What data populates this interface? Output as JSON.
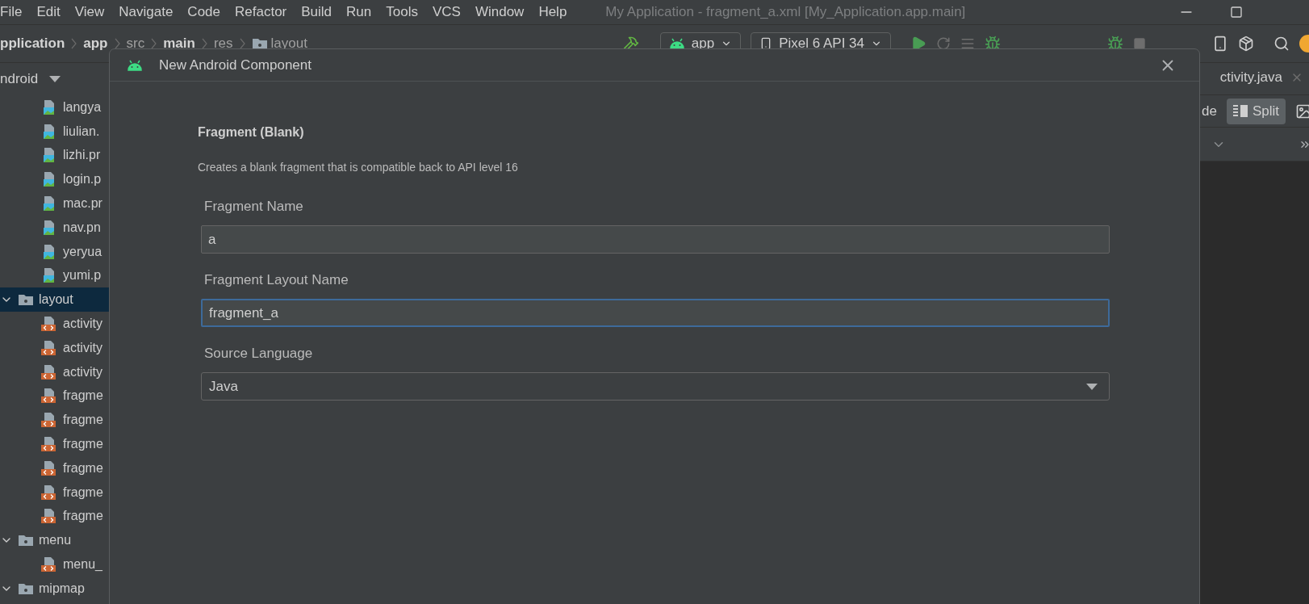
{
  "menu": [
    "File",
    "Edit",
    "View",
    "Navigate",
    "Code",
    "Refactor",
    "Build",
    "Run",
    "Tools",
    "VCS",
    "Window",
    "Help"
  ],
  "window_title": "My Application - fragment_a.xml [My_Application.app.main]",
  "breadcrumb": [
    {
      "label": "pplication",
      "bold": true,
      "kind": "plain"
    },
    {
      "label": "app",
      "bold": true,
      "kind": "plain"
    },
    {
      "label": "src",
      "bold": false,
      "kind": "plain"
    },
    {
      "label": "main",
      "bold": true,
      "kind": "plain"
    },
    {
      "label": "res",
      "bold": false,
      "kind": "plain"
    },
    {
      "label": "layout",
      "bold": false,
      "kind": "folder"
    }
  ],
  "toolbar": {
    "run_config": "app",
    "device": "Pixel 6 API 34"
  },
  "project_panel": {
    "view": "ndroid",
    "tree": [
      {
        "kind": "group",
        "children": [
          {
            "kind": "image",
            "label": "langya",
            "selected": false
          },
          {
            "kind": "image",
            "label": "liulian.",
            "selected": false
          },
          {
            "kind": "image",
            "label": "lizhi.pr",
            "selected": false
          },
          {
            "kind": "image",
            "label": "login.p",
            "selected": false
          },
          {
            "kind": "image",
            "label": "mac.pr",
            "selected": false
          },
          {
            "kind": "image",
            "label": "nav.pn",
            "selected": false
          },
          {
            "kind": "image",
            "label": "yeryua",
            "selected": false
          },
          {
            "kind": "image",
            "label": "yumi.p",
            "selected": false
          }
        ]
      },
      {
        "kind": "folder",
        "label": "layout",
        "expanded": true,
        "selected": true,
        "children": [
          {
            "kind": "layout",
            "label": "activity",
            "selected": false
          },
          {
            "kind": "layout",
            "label": "activity",
            "selected": false
          },
          {
            "kind": "layout",
            "label": "activity",
            "selected": false
          },
          {
            "kind": "layout",
            "label": "fragme",
            "selected": false
          },
          {
            "kind": "layout",
            "label": "fragme",
            "selected": false
          },
          {
            "kind": "layout",
            "label": "fragme",
            "selected": false
          },
          {
            "kind": "layout",
            "label": "fragme",
            "selected": false
          },
          {
            "kind": "layout",
            "label": "fragme",
            "selected": false
          },
          {
            "kind": "layout",
            "label": "fragme",
            "selected": false
          }
        ]
      },
      {
        "kind": "folder",
        "label": "menu",
        "expanded": true,
        "selected": false,
        "children": [
          {
            "kind": "layout",
            "label": "menu_",
            "selected": false
          }
        ]
      },
      {
        "kind": "folder",
        "label": "mipmap",
        "expanded": true,
        "selected": false
      }
    ]
  },
  "editor": {
    "tabs": [
      {
        "label": "ctivity.java",
        "selected": false
      }
    ],
    "view_modes": [
      {
        "kind": "text",
        "label": "de",
        "selected": false
      },
      {
        "kind": "split",
        "label": "Split",
        "selected": true
      },
      {
        "kind": "design",
        "selected": false
      }
    ]
  },
  "dialog": {
    "title": "New Android Component",
    "heading": "Fragment (Blank)",
    "description": "Creates a blank fragment that is compatible back to API level 16",
    "fields": [
      {
        "kind": "text",
        "label": "Fragment Name",
        "value": "a",
        "focused": false
      },
      {
        "kind": "text",
        "label": "Fragment Layout Name",
        "value": "fragment_a",
        "focused": true
      },
      {
        "kind": "select",
        "label": "Source Language",
        "value": "Java",
        "focused": false
      }
    ]
  }
}
